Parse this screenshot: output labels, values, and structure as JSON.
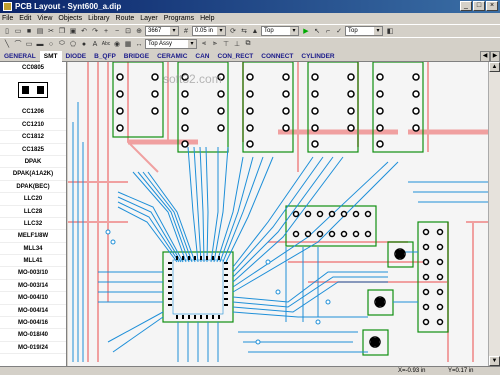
{
  "window": {
    "title": "PCB Layout - Synt600_a.dip",
    "min": "_",
    "max": "□",
    "close": "×"
  },
  "menu": [
    "File",
    "Edit",
    "View",
    "Objects",
    "Library",
    "Route",
    "Layer",
    "Programs",
    "Help"
  ],
  "toolbar1": {
    "zoom": "3667",
    "grid": "0.05 in",
    "layer": "Top",
    "layer2": "Top"
  },
  "toolbar2": {
    "assy": "Top Assy"
  },
  "tabs": [
    "GENERAL",
    "SMT",
    "DIODE",
    "B_QFP",
    "BRIDGE",
    "CERAMIC",
    "CAN",
    "CON_RECT",
    "CONNECT",
    "CYLINDER"
  ],
  "active_tab": "SMT",
  "packages": [
    "CC0805",
    "CC1206",
    "CC1210",
    "CC1812",
    "CC1825",
    "DPAK",
    "DPAK(A1A2K)",
    "DPAK(BEC)",
    "LLC20",
    "LLC28",
    "LLC32",
    "MELF1/8W",
    "MLL34",
    "MLL41",
    "MO-003/10",
    "MO-003/14",
    "MO-004/10",
    "MO-004/14",
    "MO-004/16",
    "MO-018/40",
    "MO-019/24"
  ],
  "watermark": "soft32.com",
  "status": {
    "x": "X=-0.93 in",
    "y": "Y=0.17 in"
  },
  "colors": {
    "trace_top": "#1e8fd8",
    "trace_bottom": "#f0a0a0",
    "board": "#f5f5f5",
    "pad": "#000000",
    "outline": "#109010"
  }
}
